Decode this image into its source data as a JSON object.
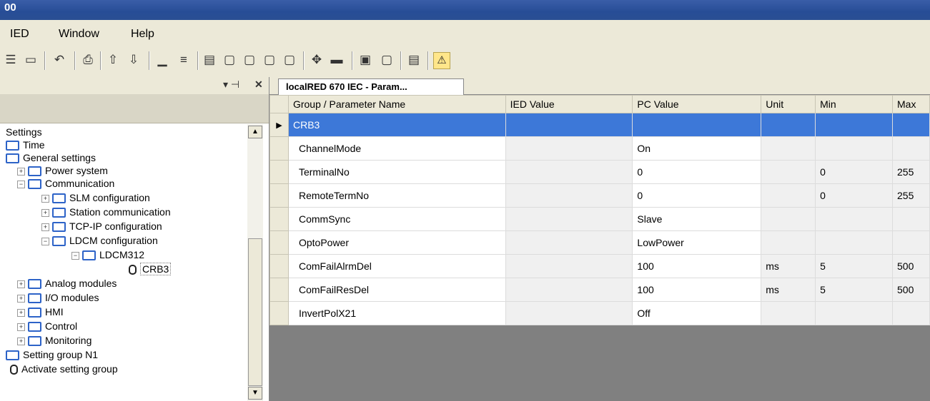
{
  "window": {
    "title": "00"
  },
  "menu": {
    "items": [
      "IED",
      "Window",
      "Help"
    ]
  },
  "toolbar": {
    "icons": [
      "list-icon",
      "panel-icon",
      "undo-icon",
      "print-icon",
      "upload-icon",
      "download-icon",
      "hline-icon",
      "lines-icon",
      "doc-icon",
      "doc2-icon",
      "doc3-icon",
      "doc4-icon",
      "doc5-icon",
      "arrows-icon",
      "minus-icon",
      "page-icon",
      "page2-icon",
      "save-icon",
      "warning-icon"
    ]
  },
  "leftpanel": {
    "controls": {
      "pin": "▾ ⊣",
      "close": "✕"
    },
    "tree": {
      "settings": "Settings",
      "time": "Time",
      "general": "General settings",
      "power": "Power system",
      "communication": "Communication",
      "slm": "SLM configuration",
      "station": "Station communication",
      "tcpip": "TCP-IP configuration",
      "ldcm": "LDCM configuration",
      "ldcm312": "LDCM312",
      "crb3": "CRB3",
      "analog": "Analog modules",
      "io": "I/O modules",
      "hmi": "HMI",
      "control": "Control",
      "monitoring": "Monitoring",
      "setgroup": "Setting group N1",
      "activate": "Activate setting group"
    }
  },
  "tab": {
    "label": "localRED 670 IEC - Param..."
  },
  "grid": {
    "columns": [
      "Group / Parameter Name",
      "IED Value",
      "PC Value",
      "Unit",
      "Min",
      "Max"
    ],
    "group": "CRB3",
    "rows": [
      [
        "ChannelMode",
        "",
        "On",
        "",
        "",
        ""
      ],
      [
        "TerminalNo",
        "",
        "0",
        "",
        "0",
        "255"
      ],
      [
        "RemoteTermNo",
        "",
        "0",
        "",
        "0",
        "255"
      ],
      [
        "CommSync",
        "",
        "Slave",
        "",
        "",
        ""
      ],
      [
        "OptoPower",
        "",
        "LowPower",
        "",
        "",
        ""
      ],
      [
        "ComFailAlrmDel",
        "",
        "100",
        "ms",
        "5",
        "500"
      ],
      [
        "ComFailResDel",
        "",
        "100",
        "ms",
        "5",
        "500"
      ],
      [
        "InvertPolX21",
        "",
        "Off",
        "",
        "",
        ""
      ]
    ]
  }
}
